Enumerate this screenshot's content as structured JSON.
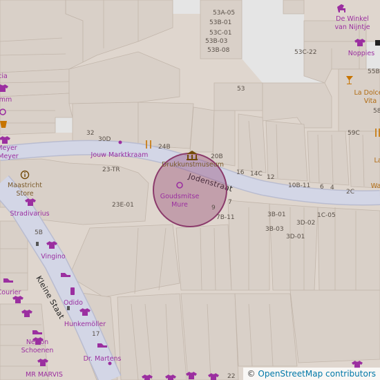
{
  "map": {
    "streets": {
      "jodenstraat": "Jodenstraat",
      "kleine_staat": "Kleine Staat"
    },
    "places": {
      "drukkunstmuseum": "Drukkunstmuseum",
      "goudsmitse_mure_line1": "Goudsmitse",
      "goudsmitse_mure_line2": "Mure",
      "jouw_marktkraam": "Jouw Marktkraam",
      "maastricht_store_line1": "Maastricht",
      "maastricht_store_line2": "Store",
      "stradivarius": "Stradivarius",
      "vingino": "Vingino",
      "odido": "Odido",
      "hunkemoller": "Hunkemöller",
      "nelson_line1": "Nelson",
      "nelson_line2": "Schoenen",
      "dr_martens": "Dr. Martens",
      "mr_marvis": "MR MARVIS",
      "de_winkel_line1": "De Winkel",
      "de_winkel_line2": "van Nijntje",
      "noppies": "Noppies",
      "la_dolce_line1": "La Dolce",
      "la_dolce_line2": "Vita",
      "meyer_line1": "Meyer",
      "meyer_line2": "Meyer",
      "courier": "Courier",
      "partial_cia": "cia",
      "partial_mm": "mm",
      "partial_la": "La",
      "partial_wa": "Wa"
    },
    "house_numbers": {
      "n53a05": "53A-05",
      "n53b01": "53B-01",
      "n53c01": "53C-01",
      "n53b03": "53B-03",
      "n53b08": "53B-08",
      "n53c22": "53C-22",
      "n53": "53",
      "n55b": "55B",
      "n58": "58",
      "n59c": "59C",
      "n32": "32",
      "n30d": "30D",
      "n24b": "24B",
      "n20b": "20B",
      "n23tr": "23-TR",
      "n16": "16",
      "n14c": "14C",
      "n12": "12",
      "n10b11": "10B-11",
      "n6": "6",
      "n4": "4",
      "n2c": "2C",
      "n23e01": "23E-01",
      "n9": "9",
      "n7": "7",
      "n7b11": "7B-11",
      "n3b01": "3B-01",
      "n3d02": "3D-02",
      "n1c05": "1C-05",
      "n3b03": "3B-03",
      "n3d01": "3D-01",
      "n5b": "5B",
      "n17": "17",
      "n22": "22"
    },
    "selection_circle": {
      "color": "#8b3a6b"
    },
    "colors": {
      "shop": "#9b2fa0",
      "road": "#d3d6e6",
      "building": "#d9d0c8",
      "background": "#dfd6ce"
    }
  },
  "attribution": {
    "prefix": "© ",
    "link_text": "OpenStreetMap contributors"
  }
}
